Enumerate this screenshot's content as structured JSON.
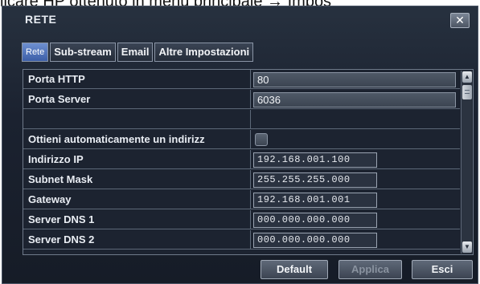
{
  "caption": "licare HP  ottenuto in menu principale → Impos",
  "dialog": {
    "title": "RETE",
    "close_label": "✕"
  },
  "tabs": [
    "Rete",
    "Sub-stream",
    "Email",
    "Altre Impostazioni"
  ],
  "active_tab": "Rete",
  "rows": [
    {
      "label": "Porta HTTP",
      "value": "80",
      "kind": "text"
    },
    {
      "label": "Porta Server",
      "value": "6036",
      "kind": "text"
    },
    {
      "label": "",
      "value": "",
      "kind": "empty"
    },
    {
      "label": "Ottieni automaticamente un indirizz",
      "value": "",
      "kind": "checkbox",
      "checked": false
    },
    {
      "label": "Indirizzo IP",
      "value": "192.168.001.100",
      "kind": "ip"
    },
    {
      "label": "Subnet Mask",
      "value": "255.255.255.000",
      "kind": "ip"
    },
    {
      "label": "Gateway",
      "value": "192.168.001.001",
      "kind": "ip"
    },
    {
      "label": "Server DNS 1",
      "value": "000.000.000.000",
      "kind": "ip"
    },
    {
      "label": "Server DNS 2",
      "value": "000.000.000.000",
      "kind": "ip"
    }
  ],
  "buttons": {
    "default": "Default",
    "apply": "Applica",
    "exit": "Esci"
  },
  "scroll": {
    "up_icon": "arrow-up-icon",
    "down_icon": "arrow-down-icon"
  }
}
